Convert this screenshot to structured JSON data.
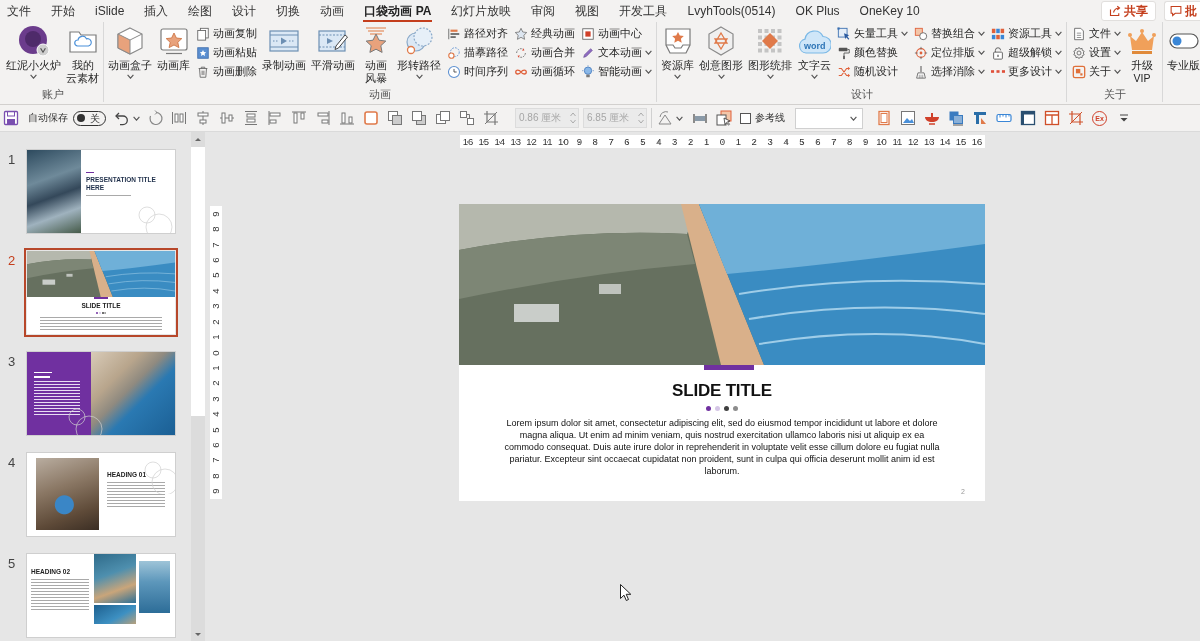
{
  "tabs": [
    {
      "label": "文件",
      "selected": false
    },
    {
      "label": "开始",
      "selected": false
    },
    {
      "label": "iSlide",
      "selected": false
    },
    {
      "label": "插入",
      "selected": false
    },
    {
      "label": "绘图",
      "selected": false
    },
    {
      "label": "设计",
      "selected": false
    },
    {
      "label": "切换",
      "selected": false
    },
    {
      "label": "动画",
      "selected": false
    },
    {
      "label": "口袋动画 PA",
      "selected": true
    },
    {
      "label": "幻灯片放映",
      "selected": false
    },
    {
      "label": "审阅",
      "selected": false
    },
    {
      "label": "视图",
      "selected": false
    },
    {
      "label": "开发工具",
      "selected": false
    },
    {
      "label": "LvyhTools(0514)",
      "selected": false
    },
    {
      "label": "OK Plus",
      "selected": false
    },
    {
      "label": "OneKey 10",
      "selected": false
    }
  ],
  "share_button": {
    "label": "共享"
  },
  "comments_button": {
    "label": "批"
  },
  "ribbon": {
    "groups": [
      {
        "label": "账户",
        "items": [
          {
            "kind": "large",
            "lines": [
              "红泥小火炉"
            ],
            "dropdown": true
          },
          {
            "kind": "large",
            "lines": [
              "我的",
              "云素材"
            ],
            "dropdown": false
          }
        ]
      },
      {
        "label": "动画",
        "items": [
          {
            "kind": "large",
            "lines": [
              "动画盒子"
            ],
            "dropdown": true
          },
          {
            "kind": "large",
            "lines": [
              "动画库"
            ],
            "dropdown": false
          },
          {
            "kind": "stack",
            "items": [
              {
                "label": "动画复制",
                "dropdown": false
              },
              {
                "label": "动画粘贴",
                "dropdown": false
              },
              {
                "label": "动画删除",
                "dropdown": false
              }
            ]
          },
          {
            "kind": "large",
            "lines": [
              "录制动画"
            ],
            "dropdown": false
          },
          {
            "kind": "large",
            "lines": [
              "平滑动画"
            ],
            "dropdown": false
          },
          {
            "kind": "large",
            "lines": [
              "动画",
              "风暴"
            ],
            "dropdown": false
          },
          {
            "kind": "large",
            "lines": [
              "形转路径"
            ],
            "dropdown": true
          },
          {
            "kind": "stack",
            "items": [
              {
                "label": "路径对齐",
                "dropdown": false
              },
              {
                "label": "描摹路径",
                "dropdown": false
              },
              {
                "label": "时间序列",
                "dropdown": false
              }
            ]
          },
          {
            "kind": "stack",
            "items": [
              {
                "label": "经典动画",
                "dropdown": false
              },
              {
                "label": "动画合并",
                "dropdown": false
              },
              {
                "label": "动画循环",
                "dropdown": false
              }
            ]
          },
          {
            "kind": "stack",
            "items": [
              {
                "label": "动画中心",
                "dropdown": false
              },
              {
                "label": "文本动画",
                "dropdown": true
              },
              {
                "label": "智能动画",
                "dropdown": true
              }
            ]
          }
        ]
      },
      {
        "label": "设计",
        "items": [
          {
            "kind": "large",
            "lines": [
              "资源库"
            ],
            "dropdown": true
          },
          {
            "kind": "large",
            "lines": [
              "创意图形"
            ],
            "dropdown": true
          },
          {
            "kind": "large",
            "lines": [
              "图形统排"
            ],
            "dropdown": true
          },
          {
            "kind": "large",
            "lines": [
              "文字云"
            ],
            "dropdown": true,
            "icon_text": "word"
          },
          {
            "kind": "stack",
            "items": [
              {
                "label": "矢量工具",
                "dropdown": true
              },
              {
                "label": "颜色替换",
                "dropdown": false
              },
              {
                "label": "随机设计",
                "dropdown": false
              }
            ]
          },
          {
            "kind": "stack",
            "items": [
              {
                "label": "替换组合",
                "dropdown": true
              },
              {
                "label": "定位排版",
                "dropdown": true
              },
              {
                "label": "选择消除",
                "dropdown": true
              }
            ]
          },
          {
            "kind": "stack",
            "items": [
              {
                "label": "资源工具",
                "dropdown": true
              },
              {
                "label": "超级解锁",
                "dropdown": true
              },
              {
                "label": "更多设计",
                "dropdown": true
              }
            ]
          }
        ]
      },
      {
        "label": "关于",
        "items": [
          {
            "kind": "stack",
            "items": [
              {
                "label": "文件",
                "dropdown": true
              },
              {
                "label": "设置",
                "dropdown": true
              },
              {
                "label": "关于",
                "dropdown": true
              }
            ]
          },
          {
            "kind": "large",
            "lines": [
              "升级",
              "VIP"
            ],
            "dropdown": false
          }
        ]
      },
      {
        "items": [
          {
            "kind": "large",
            "lines": [
              "专业版"
            ],
            "dropdown": false
          }
        ]
      }
    ]
  },
  "quick_access": {
    "autosave": {
      "label": "自动保存",
      "on": false,
      "state_label": "关"
    },
    "width_field": {
      "value": "0.86 厘米",
      "disabled": true
    },
    "height_field": {
      "value": "6.85 厘米",
      "disabled": true
    },
    "guides_checkbox": {
      "label": "参考线",
      "checked": false
    },
    "ex_button": {
      "label": "Ex"
    }
  },
  "slides": [
    {
      "number": "1",
      "kind": "title",
      "selected": false,
      "title": "PRESENTATION TITLE HERE"
    },
    {
      "number": "2",
      "kind": "banner",
      "selected": true,
      "title": "SLIDE TITLE"
    },
    {
      "number": "3",
      "kind": "panel",
      "selected": false
    },
    {
      "number": "4",
      "kind": "portrait",
      "selected": false,
      "title": "HEADING 01"
    },
    {
      "number": "5",
      "kind": "gallery",
      "selected": false,
      "title": "HEADING 02"
    }
  ],
  "rulers": {
    "horizontal": [
      "16",
      "15",
      "14",
      "13",
      "12",
      "11",
      "10",
      "9",
      "8",
      "7",
      "6",
      "5",
      "4",
      "3",
      "2",
      "1",
      "0",
      "1",
      "2",
      "3",
      "4",
      "5",
      "6",
      "7",
      "8",
      "9",
      "10",
      "11",
      "12",
      "13",
      "14",
      "15",
      "16"
    ],
    "vertical": [
      "9",
      "8",
      "7",
      "6",
      "5",
      "4",
      "3",
      "2",
      "1",
      "0",
      "1",
      "2",
      "3",
      "4",
      "5",
      "6",
      "7",
      "8",
      "9"
    ]
  },
  "slide": {
    "title": "SLIDE TITLE",
    "dots": [
      {
        "color": "#7030a0"
      },
      {
        "color": "#d5c6e6"
      },
      {
        "color": "#404040"
      },
      {
        "color": "#8c8c8c"
      }
    ],
    "body": "Lorem ipsum dolor sit amet, consectetur adipiscing elit, sed do eiusmod tempor incididunt ut labore et dolore magna aliqua. Ut enim ad minim veniam, quis nostrud exercitation ullamco laboris nisi ut aliquip ex ea commodo consequat. Duis aute irure dolor in reprehenderit in voluptate velit esse cillum dolore eu fugiat nulla pariatur. Excepteur sint occaecat cupidatat non proident, sunt in culpa qui officia deserunt mollit anim id est laborum.",
    "page_number": "2"
  }
}
